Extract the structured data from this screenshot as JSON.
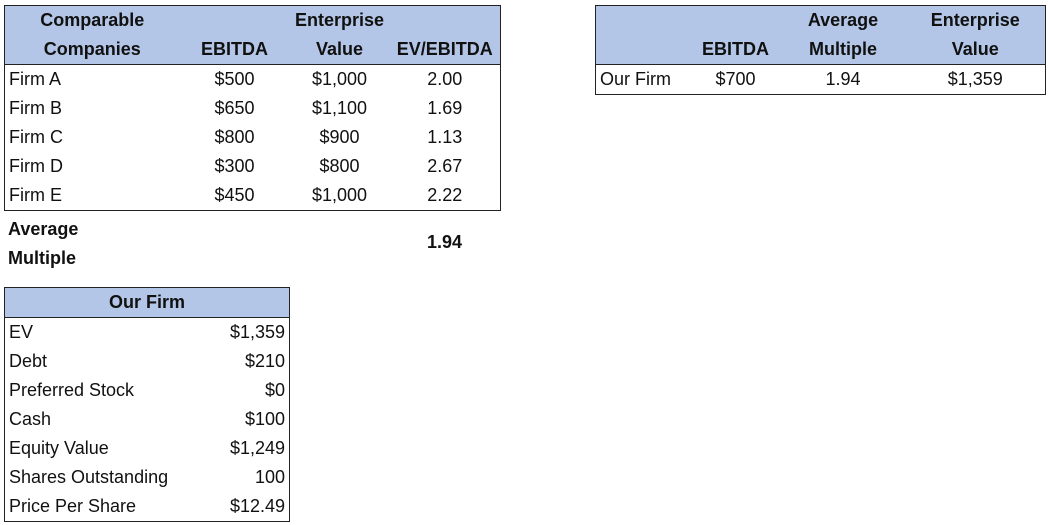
{
  "colors": {
    "header_fill": "#B4C6E7",
    "border": "#222222"
  },
  "comps_table": {
    "headers": {
      "col1_line1": "Comparable",
      "col1_line2": "Companies",
      "col2_line1": "",
      "col2_line2": "EBITDA",
      "col3_line1": "Enterprise",
      "col3_line2": "Value",
      "col4_line1": "",
      "col4_line2": "EV/EBITDA"
    },
    "rows": [
      {
        "name": "Firm A",
        "ebitda": "$500",
        "ev": "$1,000",
        "multiple": "2.00"
      },
      {
        "name": "Firm B",
        "ebitda": "$650",
        "ev": "$1,100",
        "multiple": "1.69"
      },
      {
        "name": "Firm C",
        "ebitda": "$800",
        "ev": "$900",
        "multiple": "1.13"
      },
      {
        "name": "Firm D",
        "ebitda": "$300",
        "ev": "$800",
        "multiple": "2.67"
      },
      {
        "name": "Firm E",
        "ebitda": "$450",
        "ev": "$1,000",
        "multiple": "2.22"
      }
    ],
    "average": {
      "label_line1": "Average",
      "label_line2": "Multiple",
      "value": "1.94"
    }
  },
  "valuation_table": {
    "headers": {
      "col1_line1": "",
      "col1_line2": "",
      "col2_line1": "",
      "col2_line2": "EBITDA",
      "col3_line1": "Average",
      "col3_line2": "Multiple",
      "col4_line1": "Enterprise",
      "col4_line2": "Value"
    },
    "row": {
      "name": "Our Firm",
      "ebitda": "$700",
      "multiple": "1.94",
      "ev": "$1,359"
    }
  },
  "bridge_table": {
    "title": "Our Firm",
    "rows": [
      {
        "label": "EV",
        "value": "$1,359"
      },
      {
        "label": "Debt",
        "value": "$210"
      },
      {
        "label": "Preferred Stock",
        "value": "$0"
      },
      {
        "label": "Cash",
        "value": "$100"
      },
      {
        "label": "Equity Value",
        "value": "$1,249"
      },
      {
        "label": "Shares Outstanding",
        "value": "100"
      },
      {
        "label": "Price Per Share",
        "value": "$12.49"
      }
    ]
  }
}
